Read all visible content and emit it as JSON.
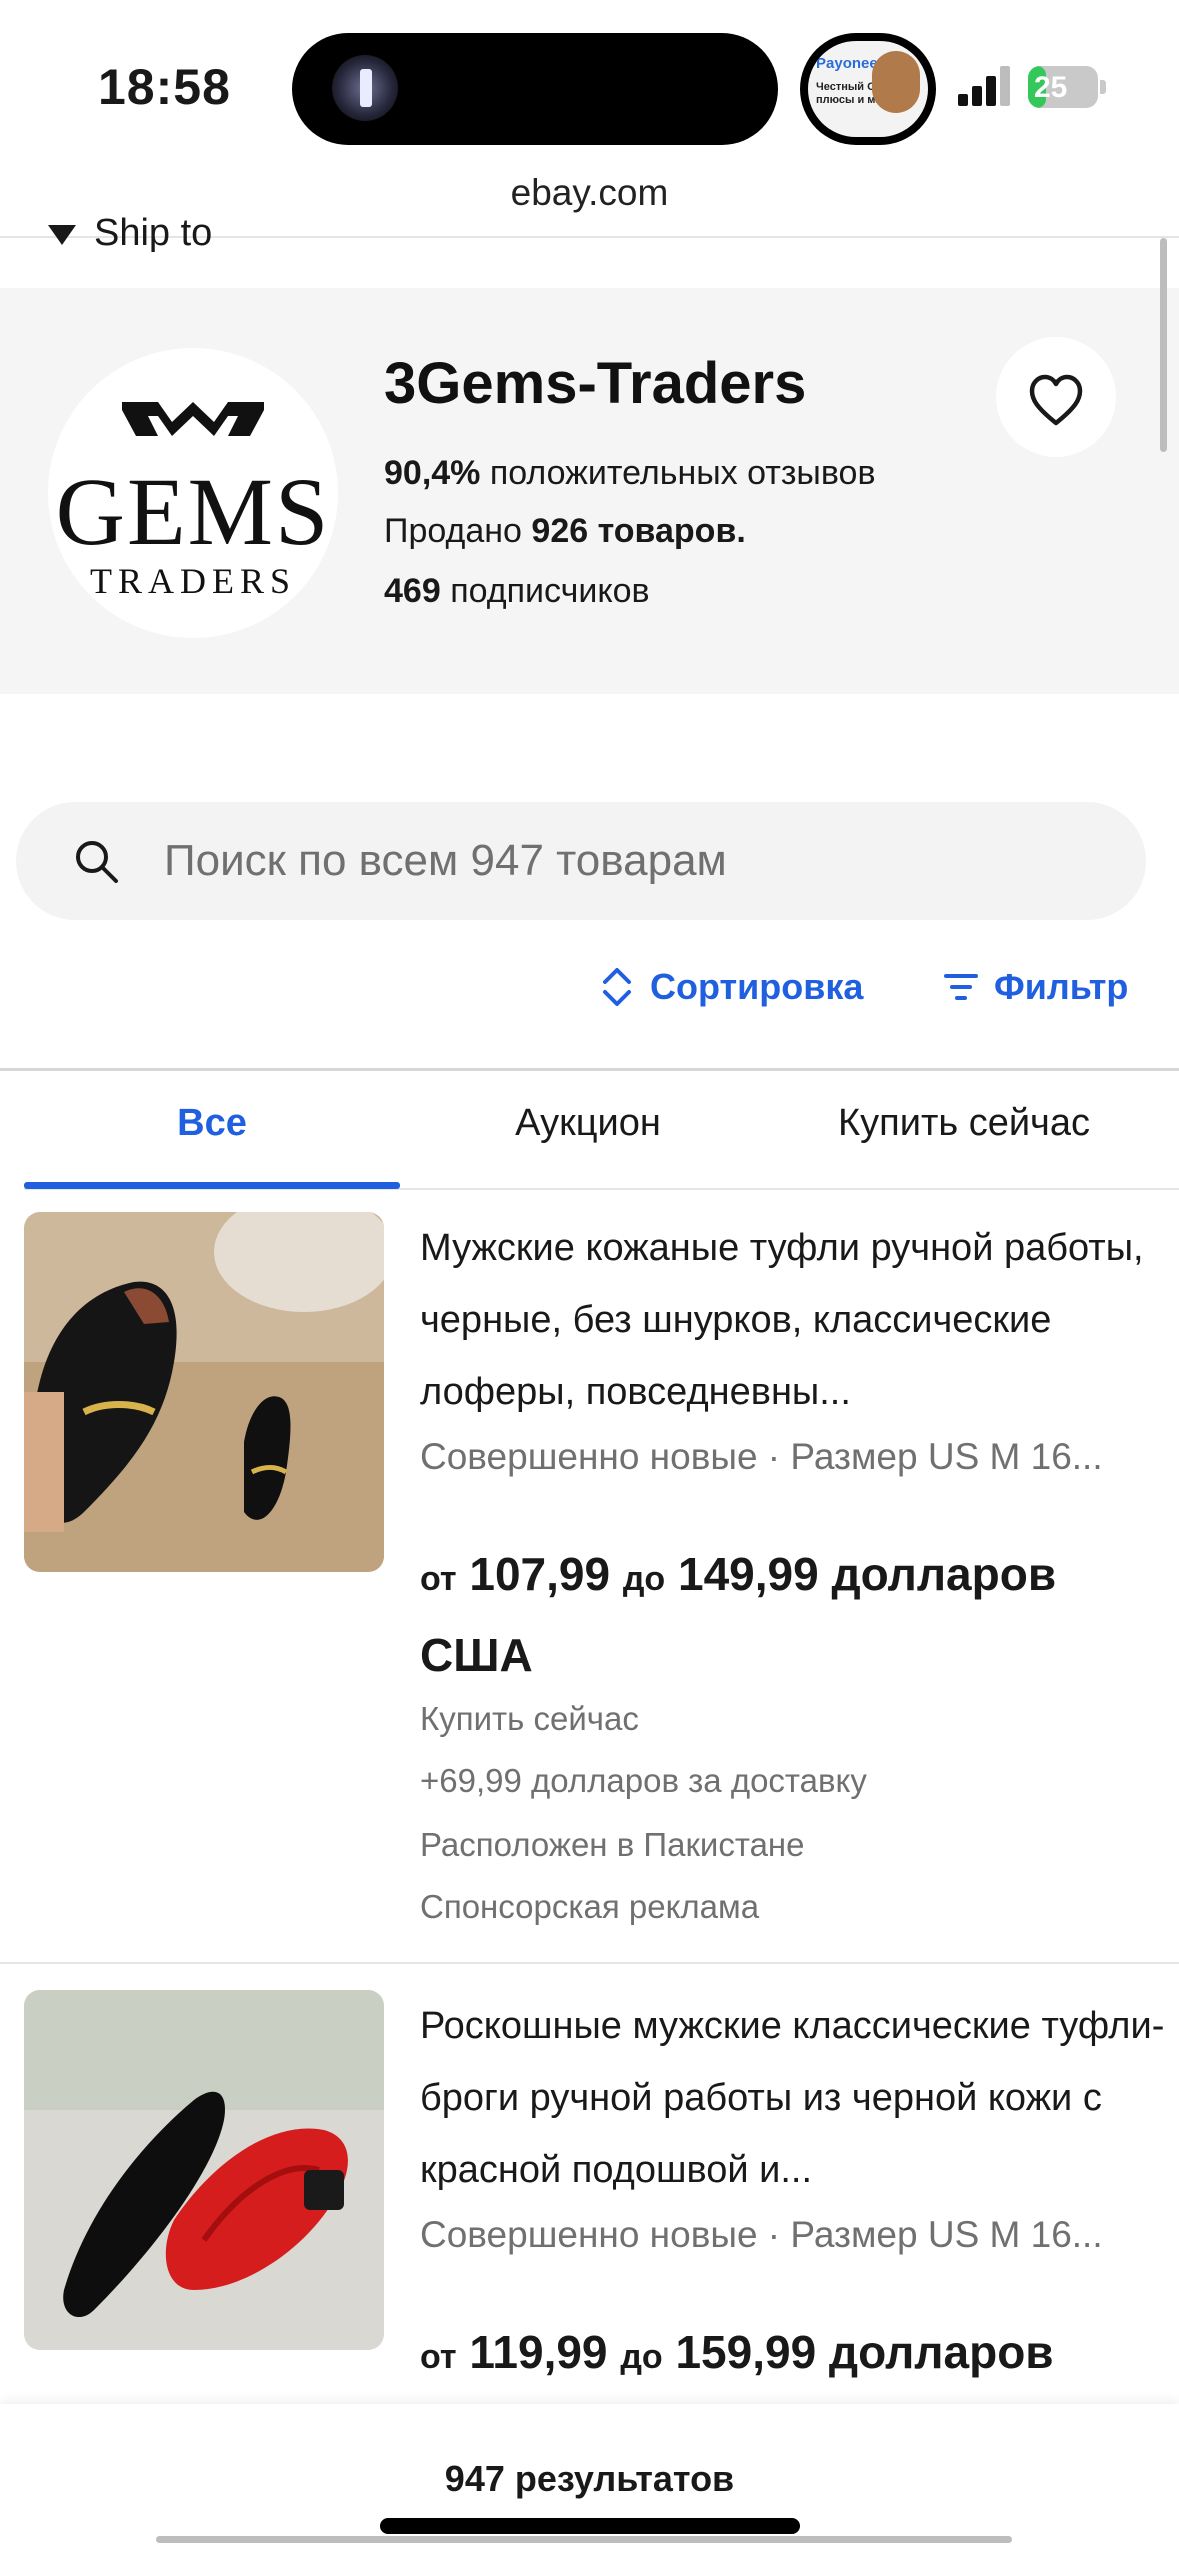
{
  "status_bar": {
    "time": "18:58",
    "battery": "25",
    "battery_level": 0.25,
    "pip": {
      "line1": "Payoneer",
      "line2": "Честный Отзыв плюсы и минусы"
    }
  },
  "browser": {
    "url": "ebay.com"
  },
  "ship_to": {
    "label": "Ship to"
  },
  "store": {
    "logo_text": "GEMS",
    "logo_subtext": "TRADERS",
    "name": "3Gems-Traders",
    "feedback_percent": "90,4%",
    "feedback_label": "положительных отзывов",
    "sold_prefix": "Продано",
    "sold_count": "926 товаров.",
    "followers_count": "469",
    "followers_label": "подписчиков"
  },
  "search": {
    "placeholder": "Поиск по всем 947 товарам"
  },
  "toolbar": {
    "sort_label": "Сортировка",
    "filter_label": "Фильтр"
  },
  "tabs": [
    {
      "label": "Все",
      "active": true
    },
    {
      "label": "Аукцион",
      "active": false
    },
    {
      "label": "Купить сейчас",
      "active": false
    }
  ],
  "listings": [
    {
      "title": "Мужские кожаные туфли ручной работы, черные, без шнурков, классические лоферы, повседневны...",
      "condition": "Совершенно новые · Размер US M 16...",
      "price_from_word": "от",
      "price_from": "107,99",
      "price_to_word": "до",
      "price_to": "149,99 долларов США",
      "buying_format": "Купить сейчас",
      "shipping": "+69,99 долларов за доставку",
      "location": "Расположен в Пакистане",
      "sponsored": "Спонсорская реклама",
      "image_icon": "black-loafer-shoe-photo"
    },
    {
      "title": "Роскошные мужские классические туфли-броги ручной работы из черной кожи с красной подошвой и...",
      "condition": "Совершенно новые · Размер US M 16...",
      "price_from_word": "от",
      "price_from": "119,99",
      "price_to_word": "до",
      "price_to": "159,99 долларов",
      "image_icon": "black-red-sole-shoe-photo"
    }
  ],
  "results": {
    "label": "947 результатов"
  },
  "colors": {
    "accent": "#1f5fe0",
    "muted_text": "#707070",
    "header_bg": "#f5f5f5"
  }
}
